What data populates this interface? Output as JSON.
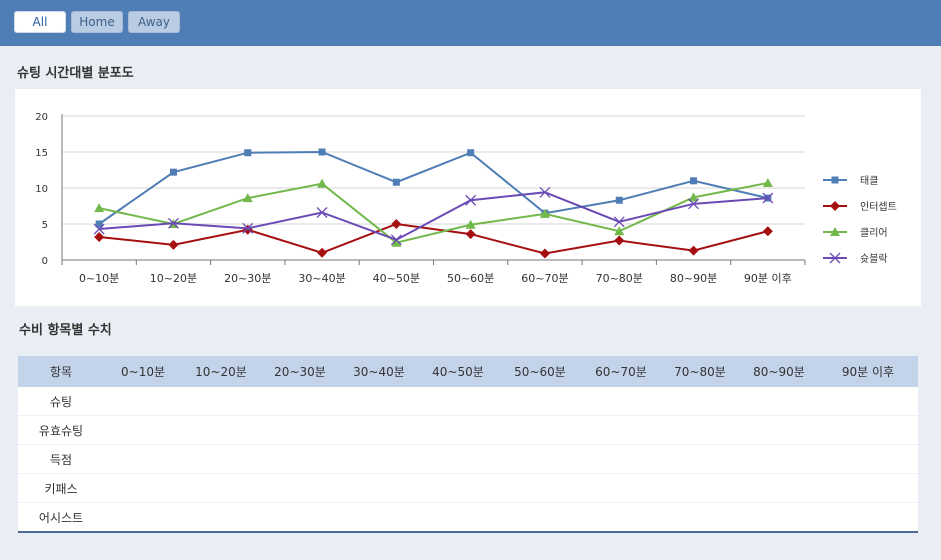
{
  "tabs": [
    {
      "label": "All",
      "active": true
    },
    {
      "label": "Home",
      "active": false
    },
    {
      "label": "Away",
      "active": false
    }
  ],
  "chart_section_title": "슈팅 시간대별 분포도",
  "table_section_title": "수비 항목별 수치",
  "chart_data": {
    "type": "line",
    "categories": [
      "0~10분",
      "10~20분",
      "20~30분",
      "30~40분",
      "40~50분",
      "50~60분",
      "60~70분",
      "70~80분",
      "80~90분",
      "90분 이후"
    ],
    "ylim": [
      0,
      20
    ],
    "yticks": [
      0,
      5,
      10,
      15,
      20
    ],
    "grid": true,
    "legend_position": "right",
    "series": [
      {
        "name": "태클",
        "color": "#4f7db5",
        "marker": "square",
        "values": [
          5,
          12.2,
          14.9,
          15,
          10.8,
          14.9,
          6.5,
          8.3,
          11,
          8.6
        ]
      },
      {
        "name": "인터셉트",
        "color": "#a50f10",
        "marker": "diamond",
        "values": [
          3.2,
          2.1,
          4.2,
          1,
          5,
          3.6,
          0.9,
          2.7,
          1.3,
          4
        ]
      },
      {
        "name": "클리어",
        "color": "#72b84a",
        "marker": "triangle",
        "values": [
          7.2,
          5,
          8.6,
          10.6,
          2.4,
          4.9,
          6.4,
          4,
          8.7,
          10.7
        ]
      },
      {
        "name": "슛블락",
        "color": "#6a4ab4",
        "marker": "x",
        "values": [
          4.3,
          5.1,
          4.4,
          6.6,
          2.8,
          8.3,
          9.4,
          5.3,
          7.8,
          8.6
        ]
      }
    ]
  },
  "table": {
    "headers": [
      "항목",
      "0~10분",
      "10~20분",
      "20~30분",
      "30~40분",
      "40~50분",
      "50~60분",
      "60~70분",
      "70~80분",
      "80~90분",
      "90분 이후"
    ],
    "rows": [
      "슈팅",
      "유효슈팅",
      "득점",
      "키패스",
      "어시스트"
    ]
  }
}
